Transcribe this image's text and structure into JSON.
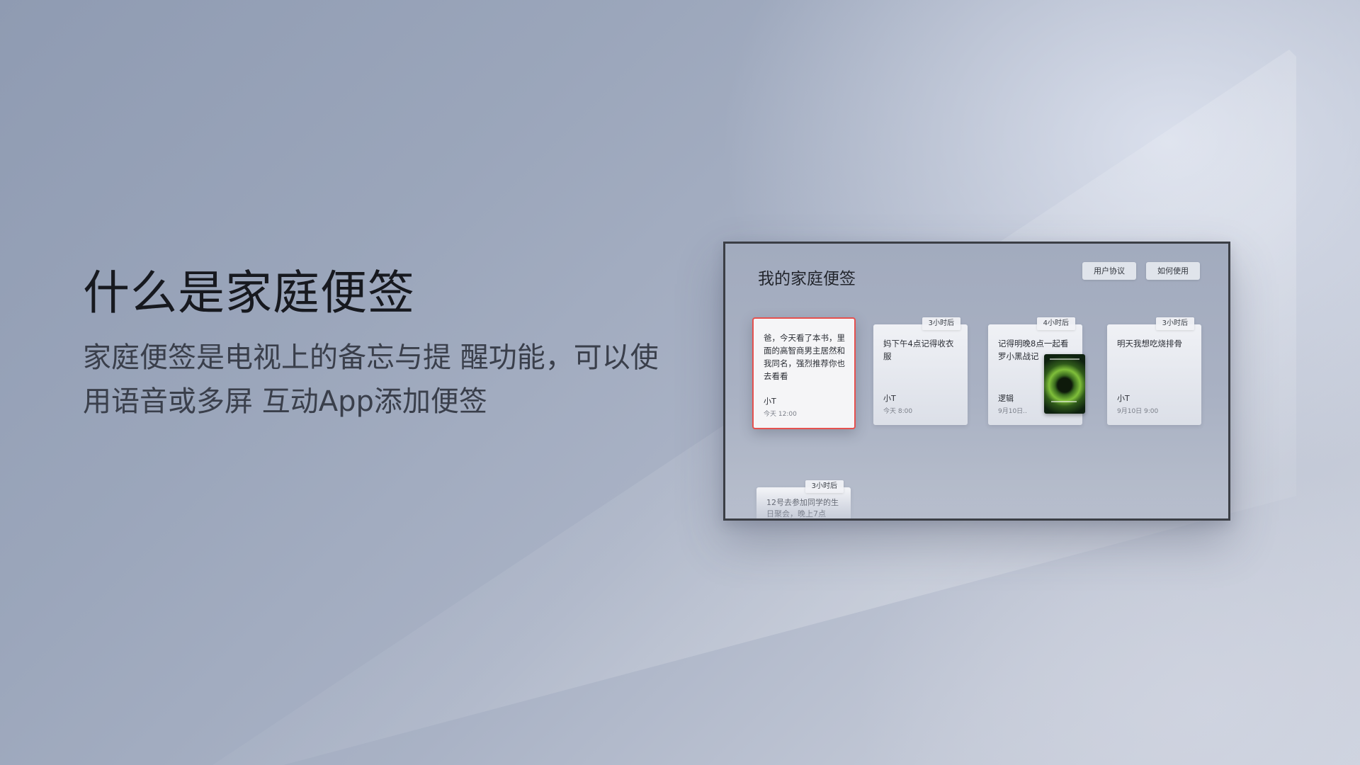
{
  "hero": {
    "title": "什么是家庭便签",
    "description_line1": "家庭便签是电视上的备忘与提 醒功能，可以使",
    "description_line2": "用语音或多屏 互动App添加便签"
  },
  "tv": {
    "title": "我的家庭便签",
    "buttons": {
      "agreement": "用户协议",
      "howto": "如何使用"
    },
    "notes": [
      {
        "text": "爸，今天看了本书，里面的高智商男主居然和我同名，强烈推荐你也去看看",
        "author": "小T",
        "time": "今天 12:00",
        "tag": "",
        "focused": true
      },
      {
        "text": "妈下午4点记得收衣服",
        "author": "小T",
        "time": "今天 8:00",
        "tag": "3小时后",
        "focused": false
      },
      {
        "text": "记得明晚8点一起看罗小黑战记",
        "author": "逻辑",
        "time": "9月10日..",
        "tag": "4小时后",
        "focused": false,
        "thumbnail": "movie-poster"
      },
      {
        "text": "明天我想吃烧排骨",
        "author": "小T",
        "time": "9月10日 9:00",
        "tag": "3小时后",
        "focused": false
      },
      {
        "text": "12号去参加同学的生日聚会，晚上7点",
        "author": "",
        "time": "",
        "tag": "3小时后",
        "focused": false
      }
    ]
  },
  "colors": {
    "focus_border": "#e5514f",
    "tv_frame": "#3b3e45"
  }
}
